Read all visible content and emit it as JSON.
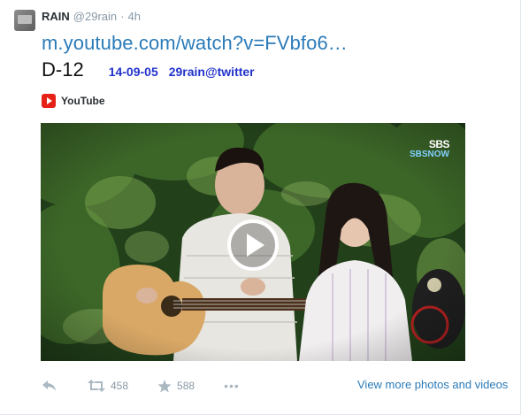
{
  "tweet": {
    "author_name": "RAIN",
    "author_handle": "@29rain",
    "separator": "·",
    "time": "4h",
    "link_text": "m.youtube.com/watch?v=FVbfo6…",
    "dday": "D-12",
    "date": "14-09-05",
    "source": "29rain@twitter"
  },
  "media": {
    "provider_label": "YouTube",
    "video_watermark_top": "SBS",
    "video_watermark_bottom": "SBSNOW"
  },
  "actions": {
    "retweet_count": "458",
    "favorite_count": "588",
    "more_label": "•••",
    "view_more_label": "View more photos and videos"
  },
  "colors": {
    "link": "#2b7bb9",
    "accent_text": "#2233cc",
    "muted": "#8899a6",
    "youtube_red": "#e62117"
  },
  "icons": [
    "avatar",
    "youtube-icon",
    "play-icon",
    "reply-icon",
    "retweet-icon",
    "favorite-star-icon",
    "more-icon"
  ]
}
